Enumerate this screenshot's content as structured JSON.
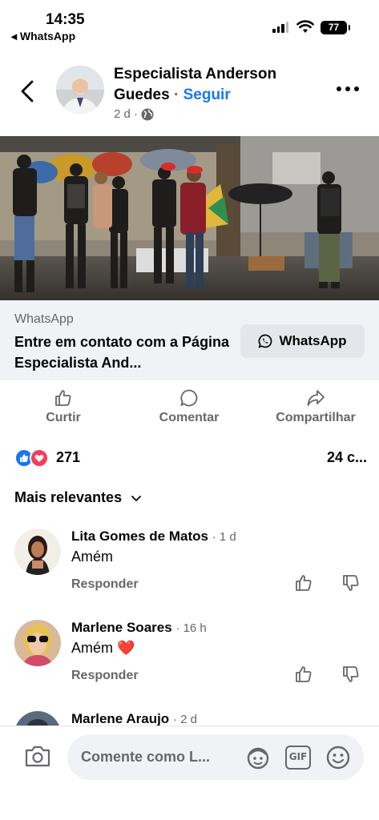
{
  "status_bar": {
    "time": "14:35",
    "back_app": "◂ WhatsApp",
    "battery": "77"
  },
  "header": {
    "page_name": "Especialista Anderson Guedes",
    "separator": " · ",
    "follow_label": "Seguir",
    "post_age": "2 d ·",
    "privacy_icon": "globe-icon"
  },
  "link_preview": {
    "source": "WhatsApp",
    "title": "Entre em contato com a Página Especialista And...",
    "button_label": "WhatsApp"
  },
  "actions": {
    "like": "Curtir",
    "comment": "Comentar",
    "share": "Compartilhar"
  },
  "reactions": {
    "count": "271",
    "comments": "24 c..."
  },
  "sort_label": "Mais relevantes",
  "comments": [
    {
      "name": "Lita Gomes de Matos",
      "time": "· 1 d",
      "text": "Amém",
      "reply": "Responder"
    },
    {
      "name": "Marlene Soares",
      "time": "· 16 h",
      "text": "Amém ❤️",
      "reply": "Responder"
    },
    {
      "name": "Marlene Araujo",
      "time": "· 2 d",
      "text": "",
      "reply": ""
    }
  ],
  "composer": {
    "placeholder": "Comente como L..."
  },
  "colors": {
    "accent": "#1877f2",
    "love": "#f33e58",
    "secondary_text": "#65676b",
    "preview_bg": "#f0f2f5"
  }
}
